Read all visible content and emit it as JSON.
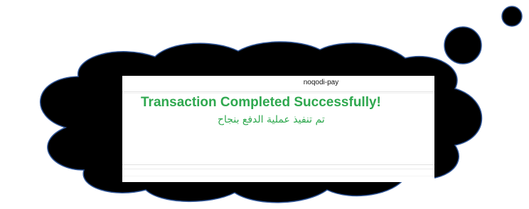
{
  "app": {
    "title": "noqodi-pay"
  },
  "message": {
    "headline": "Transaction Completed Successfully!",
    "headline_ar": "تم تنفيذ عملية الدفع بنجاح",
    "color": "#2fa84f"
  },
  "colors": {
    "cloud_fill": "#000000",
    "cloud_stroke": "#2f5597",
    "background": "#ffffff"
  }
}
